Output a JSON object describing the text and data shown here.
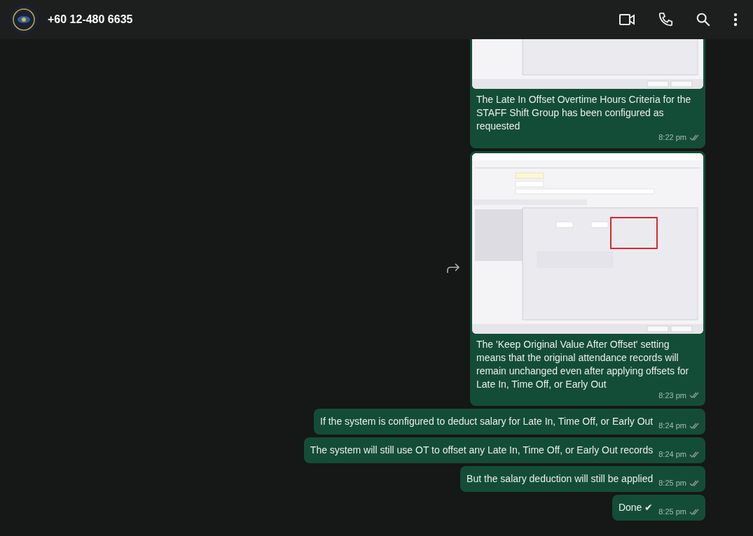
{
  "header": {
    "title": "+60 12-480 6635"
  },
  "messages": [
    {
      "caption": "The Late In Offset Overtime Hours Criteria for the STAFF Shift Group has been configured as requested",
      "time": "8:22 pm",
      "read": false,
      "forward": false
    },
    {
      "highlight": true,
      "caption": "The 'Keep Original Value After Offset' setting means that the original attendance records will remain unchanged even after applying offsets for Late In, Time Off, or Early Out",
      "time": "8:23 pm",
      "read": false,
      "forward": true
    },
    {
      "kind": "text",
      "text": "If the system is configured to deduct salary for Late In, Time Off, or Early Out",
      "time": "8:24 pm",
      "read": false,
      "forward": false
    },
    {
      "kind": "text",
      "text": "The system will still use OT to offset any Late In, Time Off, or Early Out records",
      "time": "8:24 pm",
      "read": false,
      "forward": false
    },
    {
      "kind": "text",
      "text": "But the salary deduction will still be applied",
      "time": "8:25 pm",
      "read": false,
      "forward": false
    },
    {
      "kind": "text",
      "text": "Done ✔",
      "time": "8:25 pm",
      "read": false,
      "forward": false
    }
  ]
}
